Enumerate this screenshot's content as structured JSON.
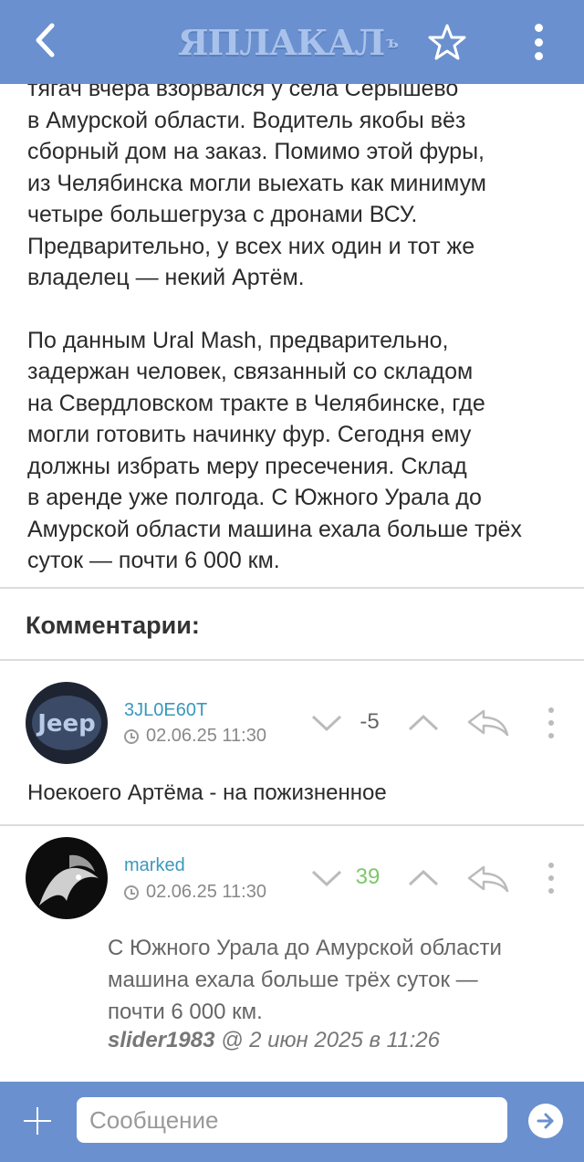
{
  "header": {
    "logo_text": "ЯПЛАКАЛ",
    "logo_sup": "ъ",
    "accent": "#6b90cf"
  },
  "article": {
    "paragraph1": "тягач вчера взорвался у села Серышево\nв Амурской области. Водитель якобы вёз\nсборный дом на заказ. Помимо этой фуры,\nиз Челябинска могли выехать как минимум\nчетыре большегруза с дронами ВСУ.\nПредварительно, у всех них один и тот же\nвладелец — некий Артём.",
    "paragraph2": "По данным Ural Mash, предварительно,\nзадержан человек, связанный со складом\nна Свердловском тракте в Челябинске, где\nмогли готовить начинку фур. Сегодня ему\nдолжны избрать меру пресечения. Склад\nв аренде уже полгода. С Южного Урала до\nАмурской области машина ехала больше трёх\nсуток — почти 6 000 км."
  },
  "comments_title": "Комментарии:",
  "comments": [
    {
      "username": "3JL0E60T",
      "date": "02.06.25 11:30",
      "score": "-5",
      "score_color": "#666666",
      "text": "Ноекоего Артёма - на пожизненное"
    },
    {
      "username": "marked",
      "date": "02.06.25 11:30",
      "score": "39",
      "score_color": "#7cc76a",
      "quote": "С Южного Урала до Амурской области\nмашина ехала больше трёх суток —\nпочти 6 000 км.",
      "quote_author": "slider1983",
      "quote_meta": " @ 2 июн 2025 в 11:26"
    }
  ],
  "composer": {
    "placeholder": "Сообщение"
  },
  "icons": [
    "back-arrow-icon",
    "star-icon",
    "kebab-menu-icon",
    "clock-icon",
    "chevron-down-icon",
    "chevron-up-icon",
    "reply-icon",
    "plus-icon",
    "send-arrow-icon"
  ]
}
